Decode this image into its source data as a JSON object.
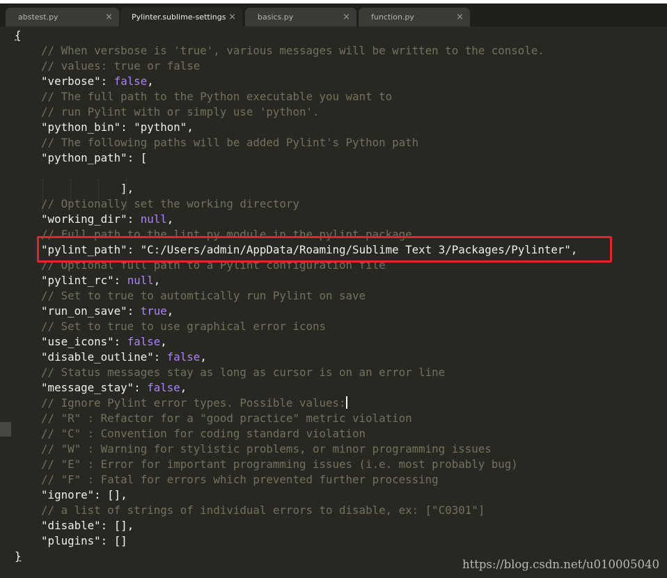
{
  "tabs": [
    {
      "label": "abstest.py",
      "close": "×",
      "active": false
    },
    {
      "label": "Pylinter.sublime-settings",
      "close": "×",
      "active": true
    },
    {
      "label": "basics.py",
      "close": "×",
      "active": false
    },
    {
      "label": "function.py",
      "close": "×",
      "active": false
    }
  ],
  "code": {
    "l1": "{",
    "l2": "// When versbose is 'true', various messages will be written to the console.",
    "l3": "// values: true or false",
    "l4k": "\"verbose\"",
    "l4v": "false",
    "l5": "// The full path to the Python executable you want to",
    "l6": "// run Pylint with or simply use 'python'.",
    "l7k": "\"python_bin\"",
    "l7v": "\"python\"",
    "l8": "// The following paths will be added Pylint's Python path",
    "l9k": "\"python_path\"",
    "l9v": "[",
    "l11": "],",
    "l12": "// Optionally set the working directory",
    "l13k": "\"working_dir\"",
    "l13v": "null",
    "l14": "// Full path to the lint.py module in the pylint package",
    "l15k": "\"pylint_path\"",
    "l15v": "\"C:/Users/admin/AppData/Roaming/Sublime Text 3/Packages/Pylinter\"",
    "l16": "// Optional full path to a Pylint configuration file",
    "l17k": "\"pylint_rc\"",
    "l17v": "null",
    "l18": "// Set to true to automtically run Pylint on save",
    "l19k": "\"run_on_save\"",
    "l19v": "true",
    "l20": "// Set to true to use graphical error icons",
    "l21k": "\"use_icons\"",
    "l21v": "false",
    "l22k": "\"disable_outline\"",
    "l22v": "false",
    "l23": "// Status messages stay as long as cursor is on an error line",
    "l24k": "\"message_stay\"",
    "l24v": "false",
    "l25": "// Ignore Pylint error types. Possible values:",
    "l26": "// \"R\" : Refactor for a \"good practice\" metric violation",
    "l27": "// \"C\" : Convention for coding standard violation",
    "l28": "// \"W\" : Warning for stylistic problems, or minor programming issues",
    "l29": "// \"E\" : Error for important programming issues (i.e. most probably bug)",
    "l30": "// \"F\" : Fatal for errors which prevented further processing",
    "l31k": "\"ignore\"",
    "l31v": "[],",
    "l32": "// a list of strings of individual errors to disable, ex: [\"C0301\"]",
    "l33k": "\"disable\"",
    "l33v": "[],",
    "l34k": "\"plugins\"",
    "l34v": "[]",
    "l35": "}"
  },
  "watermark": "https://blog.csdn.net/u010005040",
  "colors": {
    "background": "#272822",
    "comment": "#75715e",
    "constant": "#ae81ff",
    "highlight_box": "#e3242b"
  }
}
